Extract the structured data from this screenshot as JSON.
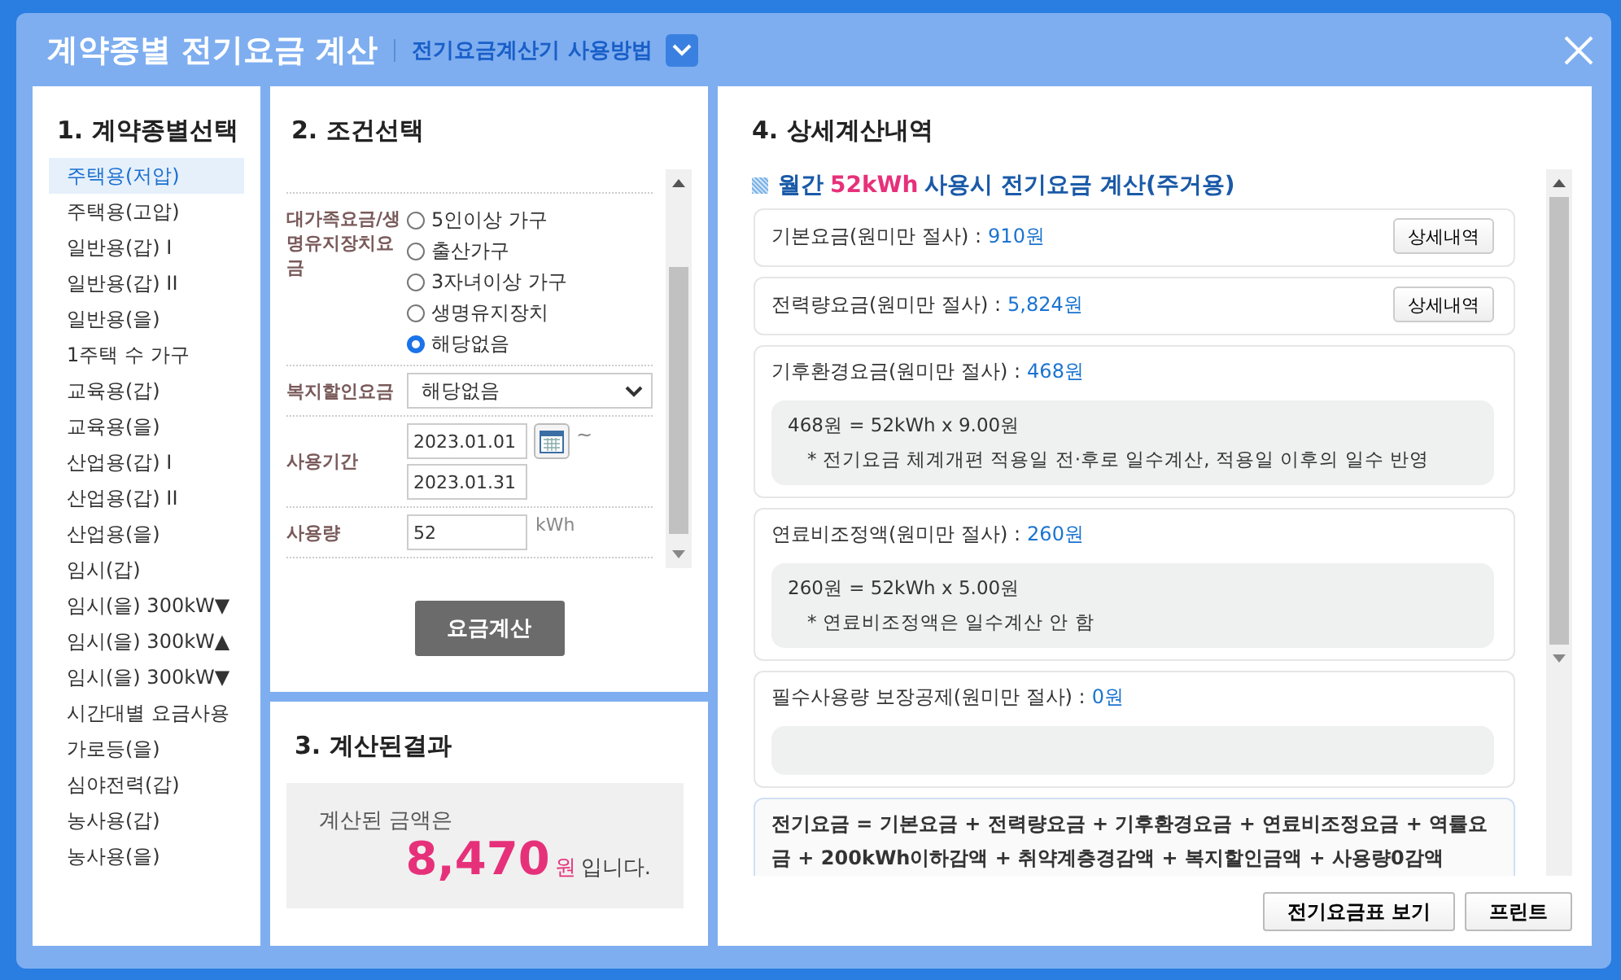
{
  "window": {
    "title": "계약종별 전기요금 계산",
    "help_link": "전기요금계산기 사용방법"
  },
  "contract_panel": {
    "heading": "1. 계약종별선택",
    "items": [
      {
        "label": "주택용(저압)",
        "selected": true
      },
      {
        "label": "주택용(고압)",
        "selected": false
      },
      {
        "label": "일반용(갑) I",
        "selected": false
      },
      {
        "label": "일반용(갑) II",
        "selected": false
      },
      {
        "label": "일반용(을)",
        "selected": false
      },
      {
        "label": "1주택 수 가구",
        "selected": false
      },
      {
        "label": "교육용(갑)",
        "selected": false
      },
      {
        "label": "교육용(을)",
        "selected": false
      },
      {
        "label": "산업용(갑) I",
        "selected": false
      },
      {
        "label": "산업용(갑) II",
        "selected": false
      },
      {
        "label": "산업용(을)",
        "selected": false
      },
      {
        "label": "임시(갑)",
        "selected": false
      },
      {
        "label": "임시(을) 300kW▼",
        "selected": false
      },
      {
        "label": "임시(을) 300kW▲",
        "selected": false
      },
      {
        "label": "임시(을) 300kW▼",
        "selected": false
      },
      {
        "label": "시간대별 요금사용",
        "selected": false
      },
      {
        "label": "가로등(을)",
        "selected": false
      },
      {
        "label": "심야전력(갑)",
        "selected": false
      },
      {
        "label": "농사용(갑)",
        "selected": false
      },
      {
        "label": "농사용(을)",
        "selected": false
      }
    ]
  },
  "condition_panel": {
    "heading": "2. 조건선택",
    "family_rate": {
      "label": "대가족요금/생명유지장치요금",
      "options": [
        {
          "label": "5인이상 가구",
          "selected": false
        },
        {
          "label": "출산가구",
          "selected": false
        },
        {
          "label": "3자녀이상 가구",
          "selected": false
        },
        {
          "label": "생명유지장치",
          "selected": false
        },
        {
          "label": "해당없음",
          "selected": true
        }
      ]
    },
    "welfare_discount": {
      "label": "복지할인요금",
      "value": "해당없음"
    },
    "period": {
      "label": "사용기간",
      "start": "2023.01.01",
      "separator": "~",
      "end": "2023.01.31"
    },
    "usage": {
      "label": "사용량",
      "value": "52",
      "unit": "kWh"
    },
    "calculate_button": "요금계산"
  },
  "result_panel": {
    "heading": "3. 계산된결과",
    "intro": "계산된 금액은",
    "amount": "8,470",
    "currency": "원",
    "suffix": "입니다."
  },
  "detail_panel": {
    "heading": "4. 상세계산내역",
    "summary_prefix": "월간",
    "summary_highlight": "52kWh",
    "summary_suffix": "사용시 전기요금 계산(주거용)",
    "items": [
      {
        "kind": "button",
        "label": "기본요금(원미만 절사) :",
        "value": "910원",
        "button": "상세내역"
      },
      {
        "kind": "button",
        "label": "전력량요금(원미만 절사) :",
        "value": "5,824원",
        "button": "상세내역"
      },
      {
        "kind": "detail",
        "label": "기후환경요금(원미만 절사) :",
        "value": "468원",
        "lines": [
          "468원 = 52kWh x 9.00원",
          "* 전기요금 체계개편 적용일 전·후로 일수계산, 적용일 이후의 일수 반영"
        ]
      },
      {
        "kind": "detail",
        "label": "연료비조정액(원미만 절사) :",
        "value": "260원",
        "lines": [
          "260원 = 52kWh x 5.00원",
          "* 연료비조정액은 일수계산 안 함"
        ]
      },
      {
        "kind": "detail",
        "label": "필수사용량 보장공제(원미만 절사) :",
        "value": "0원"
      }
    ],
    "formula": "전기요금 = 기본요금 + 전력량요금 + 기후환경요금 + 연료비조정요금 + 역률요금 + 200kWh이하감액 + 취약계층경감액 + 복지할인금액 + 사용량0감액",
    "buttons": [
      "전기요금표 보기",
      "프린트"
    ]
  }
}
